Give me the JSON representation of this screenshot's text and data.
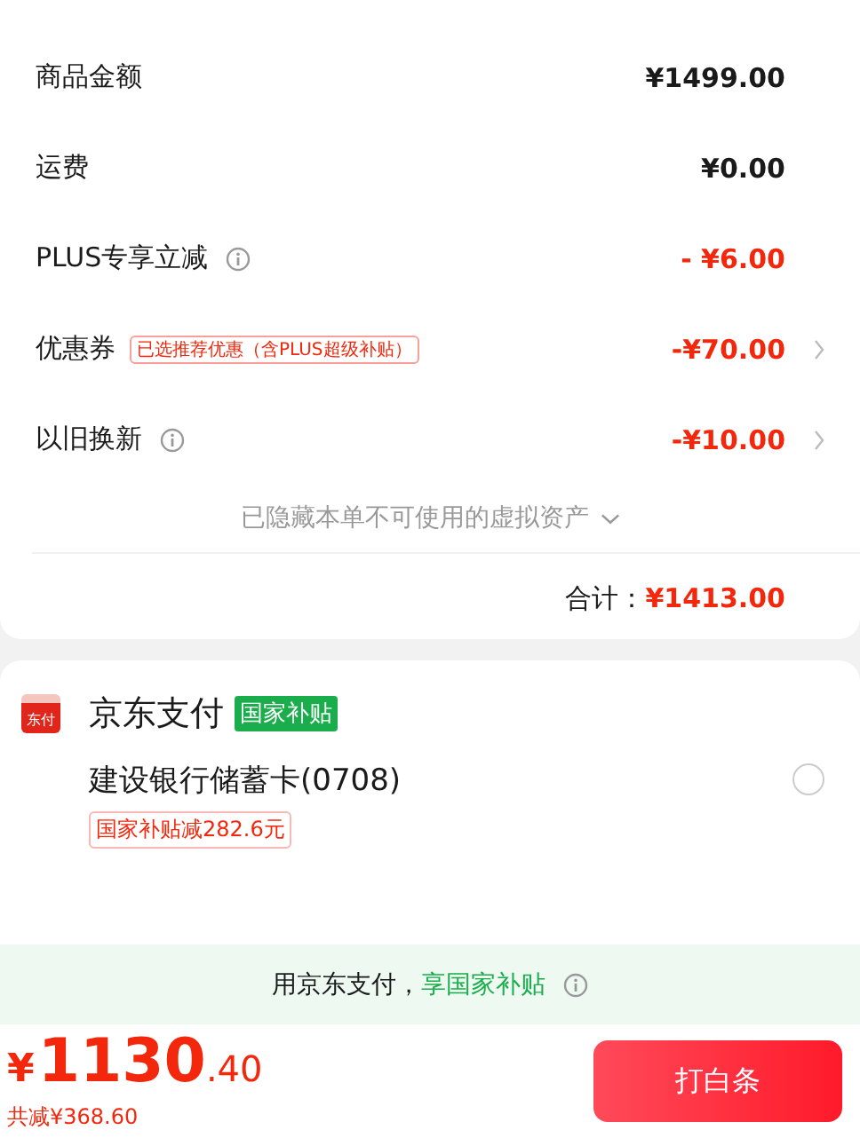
{
  "summary": {
    "rows": [
      {
        "label": "商品金额",
        "value": "¥1499.00",
        "highlight": false,
        "info": false,
        "arrow": false
      },
      {
        "label": "运费",
        "value": "¥0.00",
        "highlight": false,
        "info": false,
        "arrow": false
      },
      {
        "label": "PLUS专享立减",
        "value": "- ¥6.00",
        "highlight": true,
        "info": true,
        "arrow": false
      },
      {
        "label": "优惠券",
        "tag": "已选推荐优惠（含PLUS超级补贴）",
        "value": "-¥70.00",
        "highlight": true,
        "info": false,
        "arrow": true
      },
      {
        "label": "以旧换新",
        "value": "-¥10.00",
        "highlight": true,
        "info": true,
        "arrow": true
      }
    ],
    "hidden_note": "已隐藏本单不可使用的虚拟资产",
    "total_label": "合计：",
    "total_value": "¥1413.00"
  },
  "payment": {
    "title": "京东支付",
    "badge": "国家补贴",
    "icon_text": "东付",
    "options": [
      {
        "name": "建设银行储蓄卡(0708)",
        "tag": "国家补贴减282.6元",
        "selected": false
      }
    ]
  },
  "banner": {
    "text": "用京东支付，",
    "highlight": "享国家补贴"
  },
  "footer": {
    "currency": "¥",
    "amount": "1130",
    "decimals": ".40",
    "saved": "共减¥368.60",
    "button": "打白条"
  }
}
